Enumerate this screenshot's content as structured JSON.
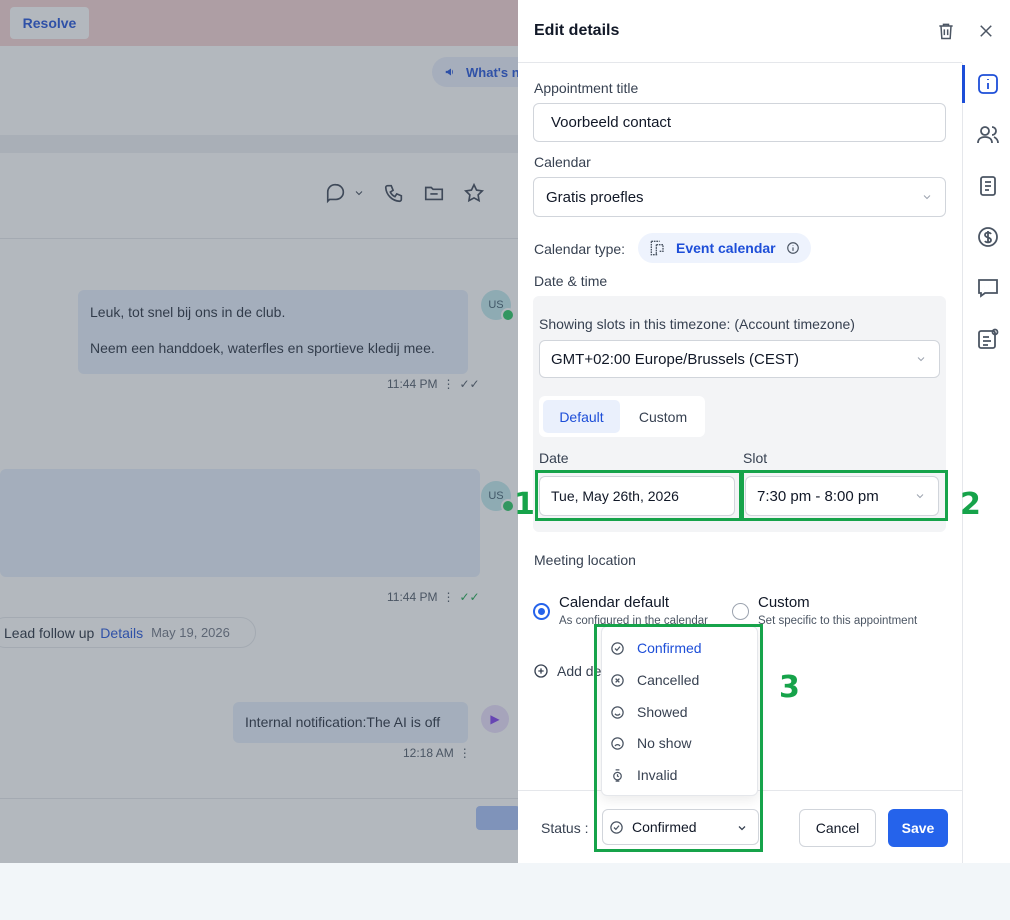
{
  "background": {
    "resolve_label": "Resolve",
    "whats_new_label": "What's n",
    "messages": [
      {
        "lines": [
          "Leuk, tot snel bij ons in de club.",
          "Neem een handdoek, waterfles en sportieve kledij mee."
        ],
        "time": "11:44 PM",
        "avatar": "US"
      },
      {
        "lines": [],
        "time": "11:44 PM",
        "avatar": "US"
      }
    ],
    "lead_chip": {
      "label": "Lead follow up",
      "link": "Details",
      "date": "May 19, 2026"
    },
    "internal_note": {
      "text": "Internal notification:The AI is off",
      "time": "12:18 AM"
    }
  },
  "drawer": {
    "title": "Edit details",
    "appointment_title_label": "Appointment title",
    "appointment_title_value": "Voorbeeld contact",
    "calendar_label": "Calendar",
    "calendar_value": "Gratis proefles",
    "calendar_type_label": "Calendar type:",
    "calendar_type_value": "Event calendar",
    "datetime_label": "Date & time",
    "timezone_label": "Showing slots in this timezone: (Account timezone)",
    "timezone_value": "GMT+02:00 Europe/Brussels (CEST)",
    "tabs": [
      "Default",
      "Custom"
    ],
    "date_label": "Date",
    "date_value": "Tue, May 26th, 2026",
    "slot_label": "Slot",
    "slot_value": "7:30 pm - 8:00 pm",
    "meeting_location_label": "Meeting location",
    "location_options": [
      {
        "title": "Calendar default",
        "sub": "As configured in the calendar"
      },
      {
        "title": "Custom",
        "sub": "Set specific to this appointment"
      }
    ],
    "add_label": "Add de",
    "status_label": "Status :",
    "status_value": "Confirmed",
    "status_options": [
      "Confirmed",
      "Cancelled",
      "Showed",
      "No show",
      "Invalid"
    ],
    "cancel_label": "Cancel",
    "save_label": "Save"
  },
  "annotations": [
    "1",
    "2",
    "3"
  ],
  "colors": {
    "accent": "#1d4ed8",
    "save": "#2563eb",
    "annotation": "#16a34a"
  }
}
